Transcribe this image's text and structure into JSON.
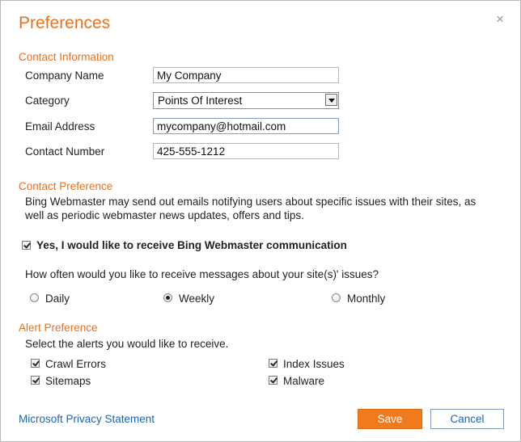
{
  "dialog": {
    "title": "Preferences",
    "close_glyph": "×"
  },
  "contact": {
    "section_title": "Contact Information",
    "company_label": "Company Name",
    "company_value": "My Company",
    "category_label": "Category",
    "category_value": "Points Of Interest",
    "email_label": "Email Address",
    "email_value": "mycompany@hotmail.com",
    "phone_label": "Contact Number",
    "phone_value": "425-555-1212"
  },
  "contact_pref": {
    "section_title": "Contact Preference",
    "description": "Bing Webmaster may send out emails notifying users about specific issues with their sites, as well as periodic webmaster news updates, offers and tips.",
    "optin_label": "Yes, I would like to receive Bing Webmaster communication",
    "optin_checked": true,
    "frequency_question": "How often would you like to receive messages about your site(s)' issues?",
    "frequency_options": [
      {
        "label": "Daily",
        "selected": false
      },
      {
        "label": "Weekly",
        "selected": true
      },
      {
        "label": "Monthly",
        "selected": false
      }
    ]
  },
  "alert_pref": {
    "section_title": "Alert Preference",
    "instruction": "Select the alerts you would like to receive.",
    "alerts": [
      {
        "label": "Crawl Errors",
        "checked": true
      },
      {
        "label": "Index Issues",
        "checked": true
      },
      {
        "label": "Sitemaps",
        "checked": true
      },
      {
        "label": "Malware",
        "checked": true
      }
    ]
  },
  "footer": {
    "privacy_link": "Microsoft Privacy Statement",
    "save_label": "Save",
    "cancel_label": "Cancel"
  },
  "colors": {
    "accent": "#e6731f",
    "save_button": "#f07a1c",
    "link": "#1d64b4"
  }
}
